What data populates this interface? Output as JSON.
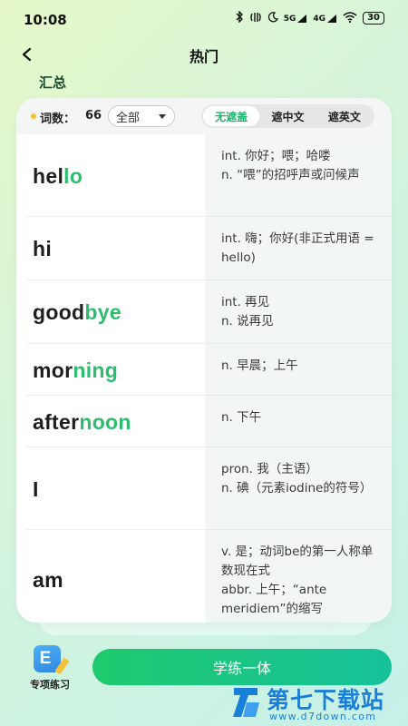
{
  "status_bar": {
    "time": "10:08",
    "signal_5g": "5G",
    "signal_4g": "4G",
    "battery": "30",
    "icons": [
      "bluetooth-icon",
      "nfc-icon",
      "moon-icon",
      "signal-icon",
      "wifi-icon",
      "battery-icon"
    ]
  },
  "header": {
    "title": "热门",
    "back_icon": "chevron-left-icon"
  },
  "section_title": "汇总",
  "toolbar": {
    "count_label": "词数：",
    "count_value": "66",
    "filter_selected": "全部",
    "modes": [
      {
        "label": "无遮盖",
        "active": true
      },
      {
        "label": "遮中文",
        "active": false
      },
      {
        "label": "遮英文",
        "active": false
      }
    ]
  },
  "words": [
    {
      "prefix": "hel",
      "highlight": "lo",
      "suffix": "",
      "meaning": "int. 你好；喂；哈喽\nn. “喂”的招呼声或问候声"
    },
    {
      "prefix": "hi",
      "highlight": "",
      "suffix": "",
      "meaning": "int. 嗨；你好(非正式用语 = hello)"
    },
    {
      "prefix": "good",
      "highlight": "bye",
      "suffix": "",
      "meaning": "int. 再见\n n. 说再见"
    },
    {
      "prefix": "mor",
      "highlight": "ning",
      "suffix": "",
      "meaning": "n. 早晨；上午"
    },
    {
      "prefix": "after",
      "highlight": "noon",
      "suffix": "",
      "meaning": "n. 下午"
    },
    {
      "prefix": "I",
      "highlight": "",
      "suffix": "",
      "meaning": "pron. 我（主语）\nn. 碘（元素iodine的符号）"
    },
    {
      "prefix": "am",
      "highlight": "",
      "suffix": "",
      "meaning": "v. 是；动词be的第一人称单数现在式\n abbr. 上午；“ante meridiem”的缩写"
    }
  ],
  "bottom": {
    "practice_label": "专项练习",
    "practice_icon": "e-pencil-icon",
    "primary_button": "学练一体"
  },
  "watermark": {
    "name": "第七下载站",
    "url": "www.d7down.com"
  },
  "colors": {
    "accent": "#19b46a",
    "word_highlight": "#2dbd6e",
    "button_gradient_start": "#1fc96e",
    "button_gradient_end": "#16c19a",
    "count_dot": "#f2c230",
    "watermark": "#1a7fd8"
  }
}
